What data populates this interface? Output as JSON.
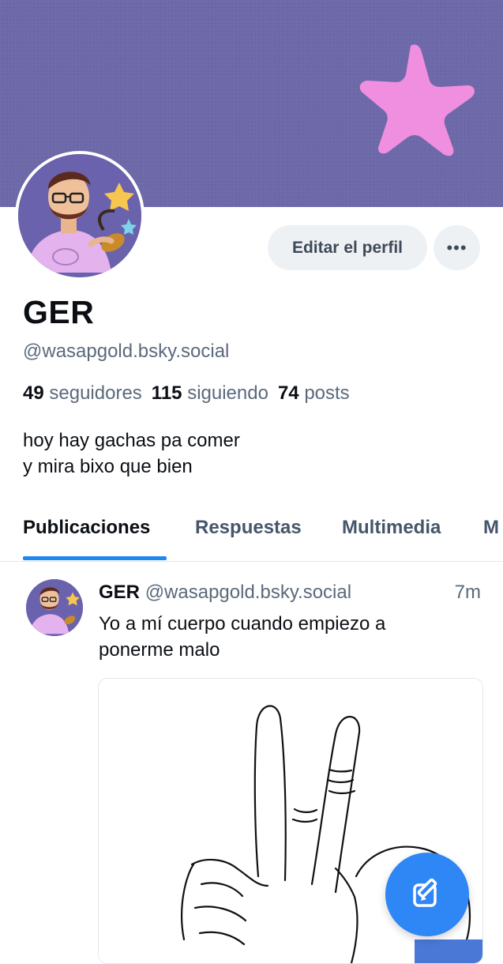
{
  "profile": {
    "name": "GER",
    "handle": "@wasapgold.bsky.social",
    "followers_count": "49",
    "followers_label": "seguidores",
    "following_count": "115",
    "following_label": "siguiendo",
    "posts_count": "74",
    "posts_label": "posts",
    "bio_line1": "hoy hay gachas pa comer",
    "bio_line2": "y mira bixo que bien"
  },
  "actions": {
    "edit_label": "Editar el perfil",
    "more_label": "•••"
  },
  "tabs": [
    {
      "label": "Publicaciones",
      "active": true
    },
    {
      "label": "Respuestas",
      "active": false
    },
    {
      "label": "Multimedia",
      "active": false
    },
    {
      "label": "M",
      "active": false
    }
  ],
  "post": {
    "author": "GER",
    "handle": "@wasapgold.bsky.social",
    "time": "7m",
    "text_line1": "Yo a mí cuerpo cuando empiezo a",
    "text_line2": "ponerme malo"
  },
  "colors": {
    "banner": "#6c67a8",
    "star": "#f08ee0",
    "accent": "#1f87f0",
    "fab": "#2f86f5"
  },
  "icons": {
    "fab": "compose-icon",
    "banner": "star-icon"
  }
}
